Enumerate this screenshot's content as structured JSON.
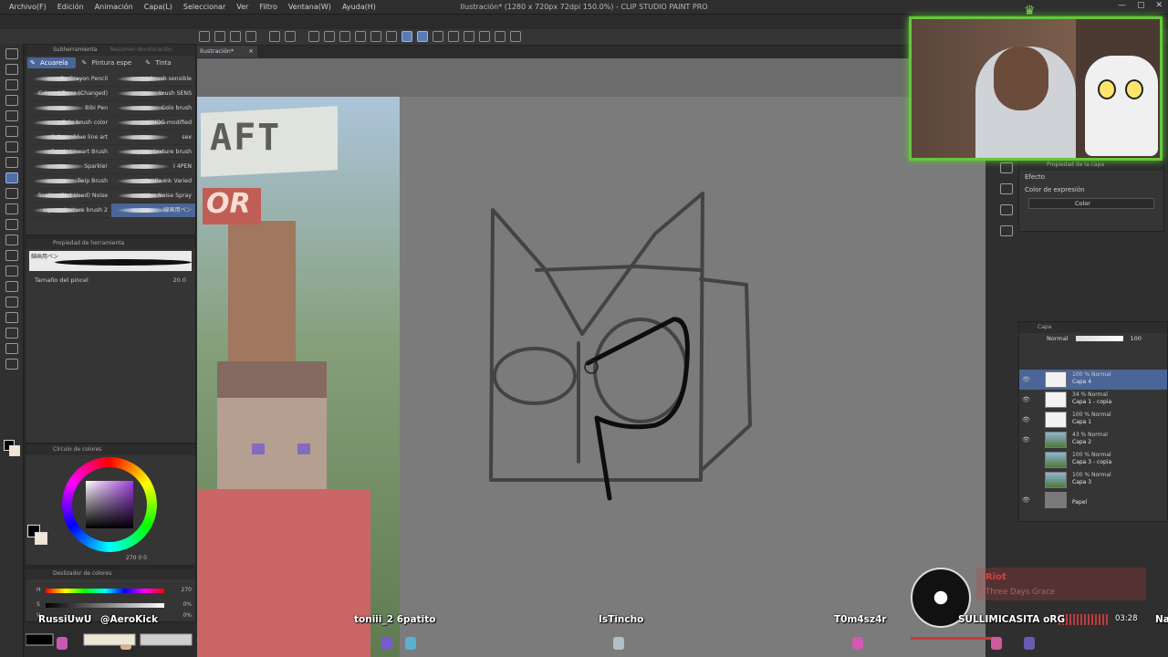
{
  "app": {
    "title": "Ilustración* (1280 x 720px 72dpi 150.0%) - CLIP STUDIO PAINT PRO",
    "menu": [
      "Archivo(F)",
      "Edición",
      "Animación",
      "Capa(L)",
      "Seleccionar",
      "Ver",
      "Filtro",
      "Ventana(W)",
      "Ayuda(H)"
    ],
    "window_controls": [
      "—",
      "▢",
      "✕"
    ]
  },
  "canvas": {
    "tab_label": "Ilustración*"
  },
  "brush_panel": {
    "header_tabs": [
      "Subherramienta",
      "Resumen decoloración"
    ],
    "tabs": [
      "Acuarela",
      "Pintura espe",
      "Tinta"
    ],
    "brushes_left": [
      "Su Crayon Pencil",
      "Colored Trees (Changed)",
      "Bibi Pen",
      "Colo brush color",
      "Subsemblue line art",
      "Comic Lineart Brush",
      "Sparkle!",
      "Twip Brush",
      "Scatter (Not Used) Noise",
      "square texture brush 2"
    ],
    "brushes_right": [
      "brush sensible",
      "brush SENS",
      "Colo brush",
      "HIMOG modified",
      "sex",
      "square texture brush",
      "I 4PEN",
      "Kaidia Ink Varied",
      "Line Noise Spray",
      "線画用ペン"
    ]
  },
  "tool_property": {
    "title": "Propiedad de herramienta",
    "preview_label": "線画用ペン",
    "brush_size_label": "Tamaño del pincel",
    "brush_size_value": "20.0"
  },
  "color_wheel": {
    "title": "Círculo de colores",
    "values": "270 0 0"
  },
  "color_slider": {
    "title": "Deslizador de colores",
    "h_label": "H",
    "h_value": "270",
    "s_label": "S",
    "s_value": "0%",
    "v_label": "V",
    "v_value": "0%"
  },
  "layer_property": {
    "title": "Propiedad de la capa",
    "effect_label": "Efecto",
    "expression_label": "Color de expresión",
    "expression_value": "Color"
  },
  "layers": {
    "title": "Capa",
    "blend_mode": "Normal",
    "opacity": "100",
    "items": [
      {
        "line1": "100 % Normal",
        "line2": "Capa 4",
        "selected": true
      },
      {
        "line1": "34 % Normal",
        "line2": "Capa 1 - copia",
        "selected": false
      },
      {
        "line1": "100 % Normal",
        "line2": "Capa 1",
        "selected": false
      },
      {
        "line1": "43 % Normal",
        "line2": "Capa 2",
        "selected": false
      },
      {
        "line1": "100 % Normal",
        "line2": "Capa 3 - copia",
        "selected": false
      },
      {
        "line1": "100 % Normal",
        "line2": "Capa 3",
        "selected": false
      },
      {
        "line1": "",
        "line2": "Papel",
        "selected": false
      }
    ]
  },
  "reference_image": {
    "logo_text": "AFT",
    "logo_text2": "OR"
  },
  "chat": {
    "names": [
      "RussiUwU",
      "@AeroKick",
      "toniii_2 6patito",
      "IsTincho",
      "T0m4sz4r",
      "SULLIMICASITA oRG",
      "Na"
    ]
  },
  "music": {
    "title": "Riot",
    "artist": "Three Days Grace",
    "time": "03:28"
  },
  "colors": {
    "accent": "#4a6596",
    "webcam_border": "#64c83a",
    "music_red": "#d94040"
  }
}
